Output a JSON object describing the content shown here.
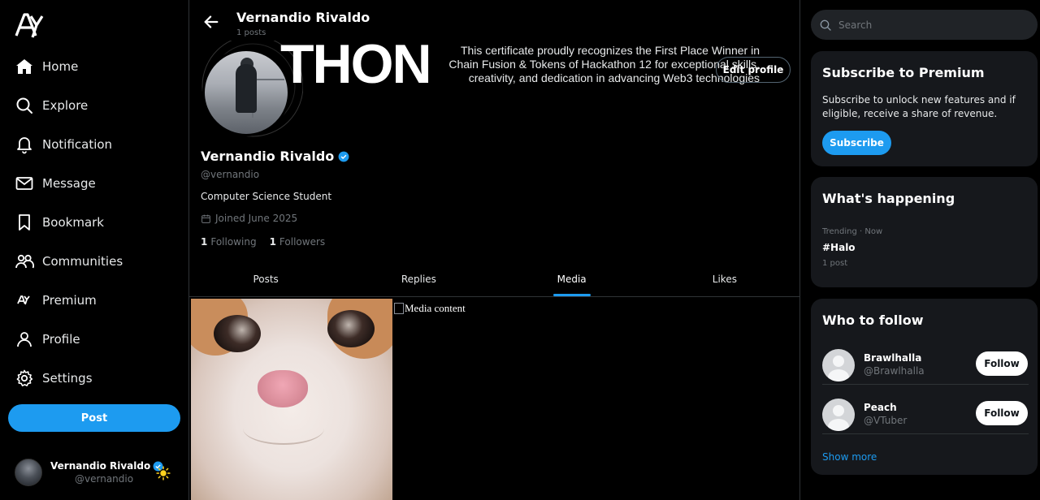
{
  "sidebar": {
    "logo_text": "AY",
    "items": [
      {
        "label": "Home",
        "icon": "home-icon"
      },
      {
        "label": "Explore",
        "icon": "search-icon"
      },
      {
        "label": "Notification",
        "icon": "bell-icon"
      },
      {
        "label": "Message",
        "icon": "mail-icon"
      },
      {
        "label": "Bookmark",
        "icon": "bookmark-icon"
      },
      {
        "label": "Communities",
        "icon": "people-icon"
      },
      {
        "label": "Premium",
        "icon": "premium-logo-icon"
      },
      {
        "label": "Profile",
        "icon": "user-icon"
      },
      {
        "label": "Settings",
        "icon": "gear-icon"
      }
    ],
    "post_label": "Post",
    "account": {
      "name": "Vernandio Rivaldo",
      "handle": "@vernandio"
    }
  },
  "profile": {
    "top_name": "Vernandio Rivaldo",
    "top_posts": "1 posts",
    "banner_big_text": "THON",
    "banner_text": "This certificate proudly recognizes the First Place Winner in Chain Fusion & Tokens of Hackathon 12 for exceptional skills, creativity, and dedication in advancing Web3 technologies",
    "edit_label": "Edit profile",
    "name": "Vernandio Rivaldo",
    "handle": "@vernandio",
    "bio": "Computer Science Student",
    "joined": "Joined June 2025",
    "following_count": "1",
    "following_label": "Following",
    "followers_count": "1",
    "followers_label": "Followers"
  },
  "tabs": [
    {
      "label": "Posts"
    },
    {
      "label": "Replies"
    },
    {
      "label": "Media",
      "active": true
    },
    {
      "label": "Likes"
    }
  ],
  "media": {
    "broken_alt": "Media content"
  },
  "right": {
    "search_placeholder": "Search",
    "premium": {
      "title": "Subscribe to Premium",
      "desc": "Subscribe to unlock new features and if eligible, receive a share of revenue.",
      "button": "Subscribe"
    },
    "happening": {
      "title": "What's happening",
      "meta": "Trending · Now",
      "tag": "#Halo",
      "count": "1 post"
    },
    "follow": {
      "title": "Who to follow",
      "users": [
        {
          "name": "Brawlhalla",
          "handle": "@Brawlhalla",
          "button": "Follow"
        },
        {
          "name": "Peach",
          "handle": "@VTuber",
          "button": "Follow"
        }
      ],
      "show_more": "Show more"
    }
  },
  "colors": {
    "accent": "#1d9bf0",
    "background": "#000000",
    "card": "#16181c",
    "muted": "#71767b"
  }
}
